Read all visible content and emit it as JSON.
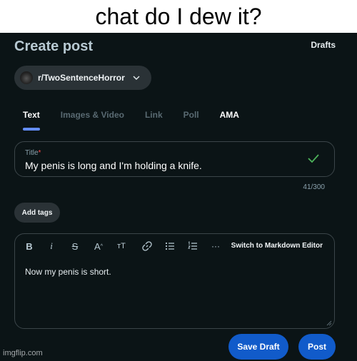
{
  "caption": "chat do I dew it?",
  "header": {
    "title": "Create post",
    "drafts_label": "Drafts"
  },
  "community": {
    "name": "r/TwoSentenceHorror"
  },
  "tabs": [
    {
      "label": "Text"
    },
    {
      "label": "Images & Video"
    },
    {
      "label": "Link"
    },
    {
      "label": "Poll"
    },
    {
      "label": "AMA"
    }
  ],
  "title_field": {
    "label": "Title",
    "required_mark": "*",
    "value": "My penis is long and I'm holding a knife.",
    "counter": "41/300"
  },
  "tags_button": "Add tags",
  "editor": {
    "toolbar": [
      "bold-icon",
      "italic-icon",
      "strikethrough-icon",
      "superscript-icon",
      "heading-icon",
      "link-icon",
      "bullet-list-icon",
      "numbered-list-icon",
      "more-icon"
    ],
    "markdown_switch": "Switch to Markdown Editor",
    "body": "Now my penis is short."
  },
  "actions": {
    "save_draft": "Save Draft",
    "post": "Post"
  },
  "watermark": "imgflip.com",
  "colors": {
    "background": "#0b1416",
    "accent": "#115bca",
    "tab_indicator": "#648efc",
    "check": "#4db35a"
  }
}
